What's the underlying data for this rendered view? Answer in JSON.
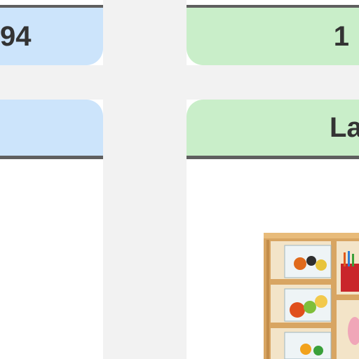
{
  "left_card": {
    "top_value": "94"
  },
  "right_card": {
    "top_value": "1",
    "bottom_label": "La"
  },
  "colors": {
    "left_card_bg": "#cce4fb",
    "right_card_bg": "#c9eec9",
    "divider": "#5f5f5f",
    "gutter": "#f2f2f2"
  },
  "product_image": {
    "icon": "storage-cubby-shelf-image"
  }
}
